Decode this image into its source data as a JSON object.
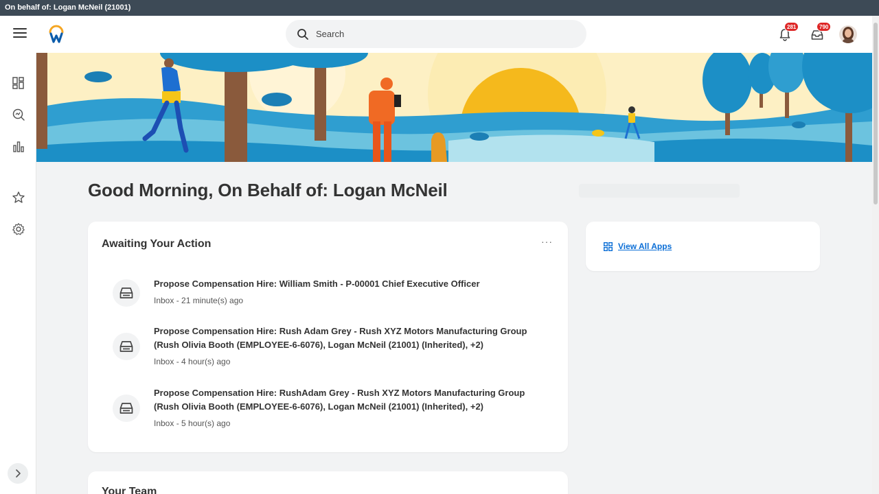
{
  "proxy": {
    "text": "On behalf of: Logan McNeil (21001)"
  },
  "header": {
    "search_placeholder": "Search",
    "notifications_count": "281",
    "inbox_count": "790"
  },
  "greeting": "Good Morning, On Behalf of: Logan McNeil",
  "awaiting": {
    "title": "Awaiting Your Action",
    "more_label": "···",
    "items": [
      {
        "title": "Propose Compensation Hire: William Smith - P-00001 Chief Executive Officer",
        "subtitle": "Inbox - 21 minute(s) ago"
      },
      {
        "title": "Propose Compensation Hire: Rush Adam Grey - Rush XYZ Motors Manufacturing Group (Rush Olivia Booth (EMPLOYEE-6-6076), Logan McNeil (21001) (Inherited), +2)",
        "subtitle": "Inbox - 4 hour(s) ago"
      },
      {
        "title": "Propose Compensation Hire: RushAdam Grey - Rush XYZ Motors Manufacturing Group (Rush Olivia Booth (EMPLOYEE-6-6076), Logan McNeil (21001) (Inherited), +2)",
        "subtitle": "Inbox - 5 hour(s) ago"
      }
    ]
  },
  "apps": {
    "link_label": "View All Apps"
  },
  "team": {
    "title": "Your Team"
  },
  "colors": {
    "accent": "#0b6ed6",
    "badge": "#de2626",
    "proxy_bar": "#3d4a56"
  },
  "icons": {
    "sidebar": [
      "apps-grid-icon",
      "search-insights-icon",
      "bar-chart-icon",
      "star-icon",
      "gear-icon"
    ],
    "header": [
      "menu-icon",
      "workday-logo",
      "search-icon",
      "bell-icon",
      "inbox-icon"
    ],
    "task": "inbox-tray-icon"
  }
}
